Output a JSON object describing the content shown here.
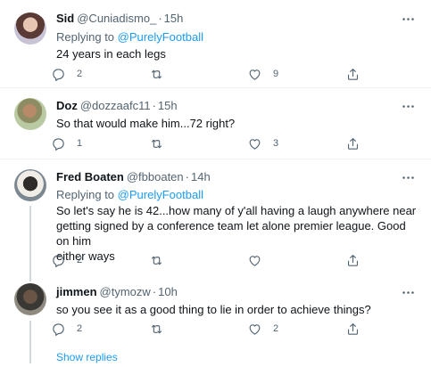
{
  "colors": {
    "accent": "#1d9bf0",
    "secondary_text": "#536471",
    "primary_text": "#0f1419",
    "divider": "#eff3f4",
    "thread_line": "#cfd9de"
  },
  "tweets": [
    {
      "name": "Sid",
      "handle": "@Cuniadismo_",
      "separator": "·",
      "time": "15h",
      "replying_prefix": "Replying to",
      "replying_to": "@PurelyFootball",
      "text": "24 years in each legs",
      "reply_count": "2",
      "retweet_count": "",
      "like_count": "9"
    },
    {
      "name": "Doz",
      "handle": "@dozzaafc11",
      "separator": "·",
      "time": "15h",
      "text": "So that would make him...72 right?",
      "reply_count": "1",
      "retweet_count": "",
      "like_count": "3"
    },
    {
      "name": "Fred Boaten",
      "handle": "@fbboaten",
      "separator": "·",
      "time": "14h",
      "replying_prefix": "Replying to",
      "replying_to": "@PurelyFootball",
      "text_lines": [
        "So let's say he is 42...how many of y'all having a laugh anywhere near",
        "getting signed by a conference team let alone premier league. Good on him",
        "either ways"
      ],
      "reply_count": "2",
      "retweet_count": "",
      "like_count": ""
    },
    {
      "name": "jimmen",
      "handle": "@tymozw",
      "separator": "·",
      "time": "10h",
      "text": "so you see it as a good thing to lie in order to achieve things?",
      "reply_count": "2",
      "retweet_count": "",
      "like_count": "2"
    }
  ],
  "show_replies_label": "Show replies",
  "icons": [
    "more-icon",
    "reply-icon",
    "retweet-icon",
    "like-icon",
    "share-icon"
  ]
}
